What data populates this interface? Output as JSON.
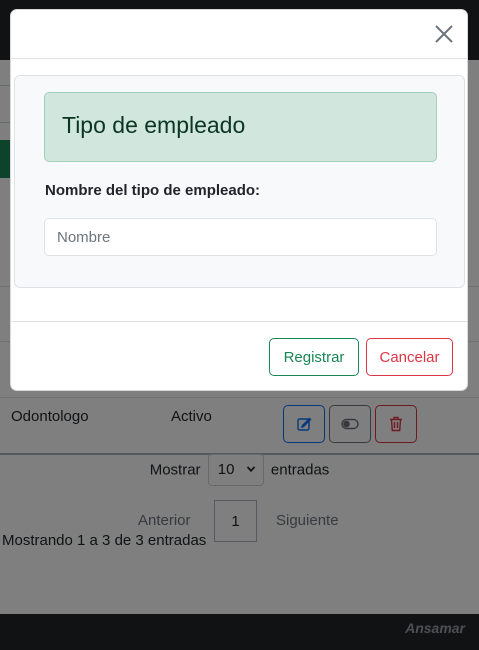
{
  "background": {
    "table_row": {
      "name": "Odontologo",
      "status": "Activo",
      "actions": [
        "edit-icon",
        "toggle-icon",
        "trash-icon"
      ]
    },
    "length_menu": {
      "prefix": "Mostrar",
      "selected": "10",
      "suffix": "entradas"
    },
    "pagination": {
      "previous": "Anterior",
      "current_page": "1",
      "next": "Siguiente"
    },
    "info": "Mostrando 1 a 3 de 3 entradas",
    "footer_brand": "Ansamar"
  },
  "modal": {
    "close_icon": "close-icon",
    "alert_title": "Tipo de empleado",
    "field_label": "Nombre del tipo de empleado:",
    "field_placeholder": "Nombre",
    "field_value": "",
    "register_label": "Registrar",
    "cancel_label": "Cancelar"
  },
  "colors": {
    "success": "#198754",
    "danger": "#dc3545",
    "primary": "#0d6efd",
    "alert_bg": "#d1e7dd",
    "dark": "#212529"
  }
}
